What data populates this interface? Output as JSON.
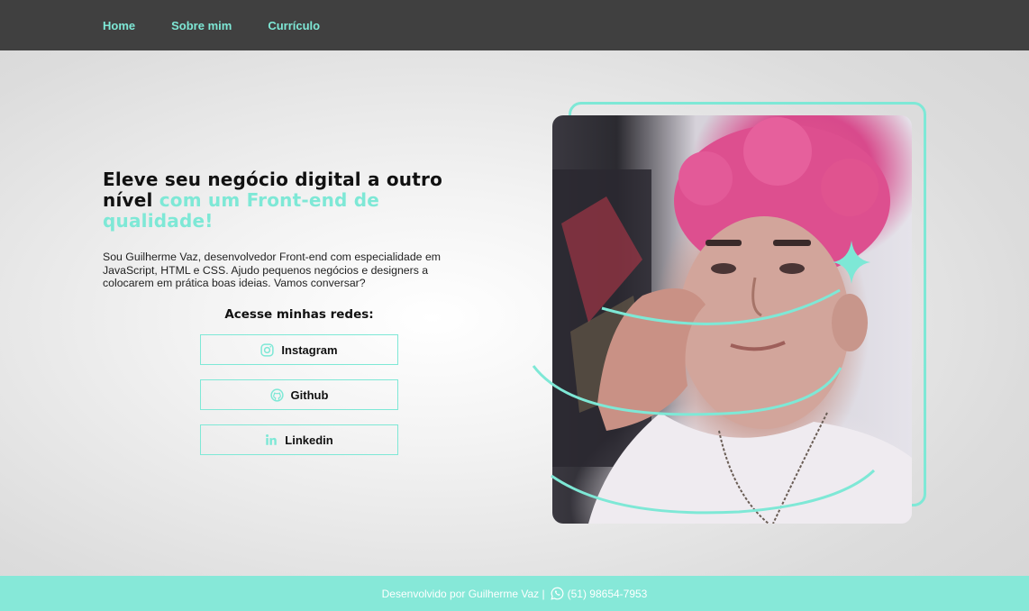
{
  "nav": {
    "items": [
      {
        "label": "Home"
      },
      {
        "label": "Sobre mim"
      },
      {
        "label": "Currículo"
      }
    ]
  },
  "hero": {
    "title_plain": "Eleve seu negócio digital a outro nível",
    "title_accent": "com um Front-end de qualidade!",
    "description": "Sou Guilherme Vaz, desenvolvedor Front-end com especialidade em JavaScript, HTML e CSS. Ajudo pequenos negócios e designers a colocarem em prática boas ideias. Vamos conversar?",
    "photo_icon": "profile-photo"
  },
  "social": {
    "heading": "Acesse minhas redes:",
    "buttons": [
      {
        "label": "Instagram",
        "icon": "instagram-icon"
      },
      {
        "label": "Github",
        "icon": "github-icon"
      },
      {
        "label": "Linkedin",
        "icon": "linkedin-icon"
      }
    ]
  },
  "footer": {
    "text": "Desenvolvido por Guilherme Vaz |",
    "phone": "(51) 98654-7953",
    "icon": "whatsapp-icon"
  },
  "colors": {
    "accent": "#7ee8d6",
    "nav_bg": "#404040",
    "footer_bg": "#86e8d8",
    "text": "#111111"
  }
}
